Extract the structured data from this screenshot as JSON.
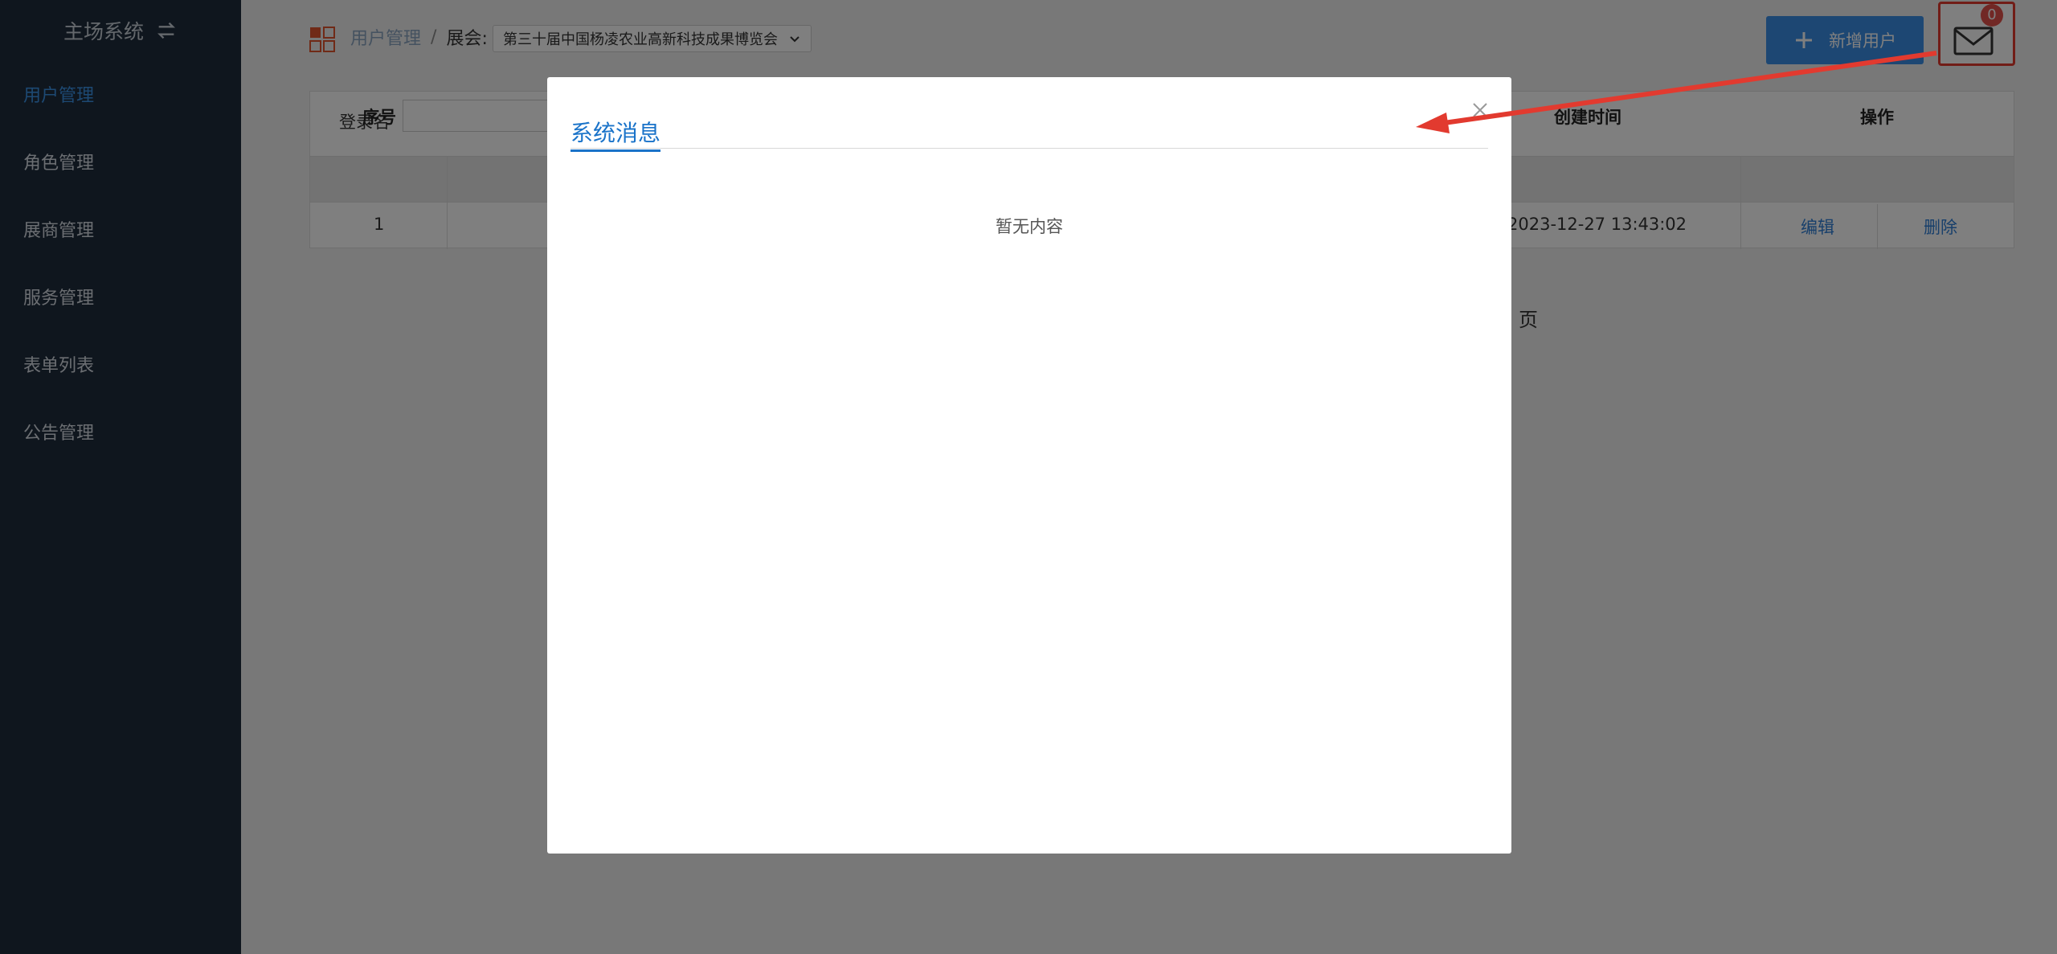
{
  "sidebar": {
    "title": "主场系统",
    "items": [
      {
        "label": "用户管理",
        "active": true
      },
      {
        "label": "角色管理"
      },
      {
        "label": "展商管理"
      },
      {
        "label": "服务管理"
      },
      {
        "label": "表单列表"
      },
      {
        "label": "公告管理"
      }
    ]
  },
  "header": {
    "breadcrumb": "用户管理",
    "separator": "/",
    "expo_label": "展会:",
    "expo_selected": "第三十届中国杨凌农业高新科技成果博览会",
    "add_user_label": "新增用户",
    "mail_badge": "0"
  },
  "search": {
    "login_label": "登录名"
  },
  "table": {
    "columns": [
      "序号",
      "创建时间",
      "操作"
    ],
    "rows": [
      {
        "index": "1",
        "created": "2023-12-27 13:43:02",
        "edit": "编辑",
        "delete": "删除"
      }
    ]
  },
  "pagination": {
    "page_text": "页"
  },
  "modal": {
    "title": "系统消息",
    "close_icon": "close-icon",
    "empty": "暂无内容"
  },
  "colors": {
    "sidebar_bg": "#1f2c3d",
    "accent": "#3a8ee6",
    "annotation": "#e23a2f"
  }
}
